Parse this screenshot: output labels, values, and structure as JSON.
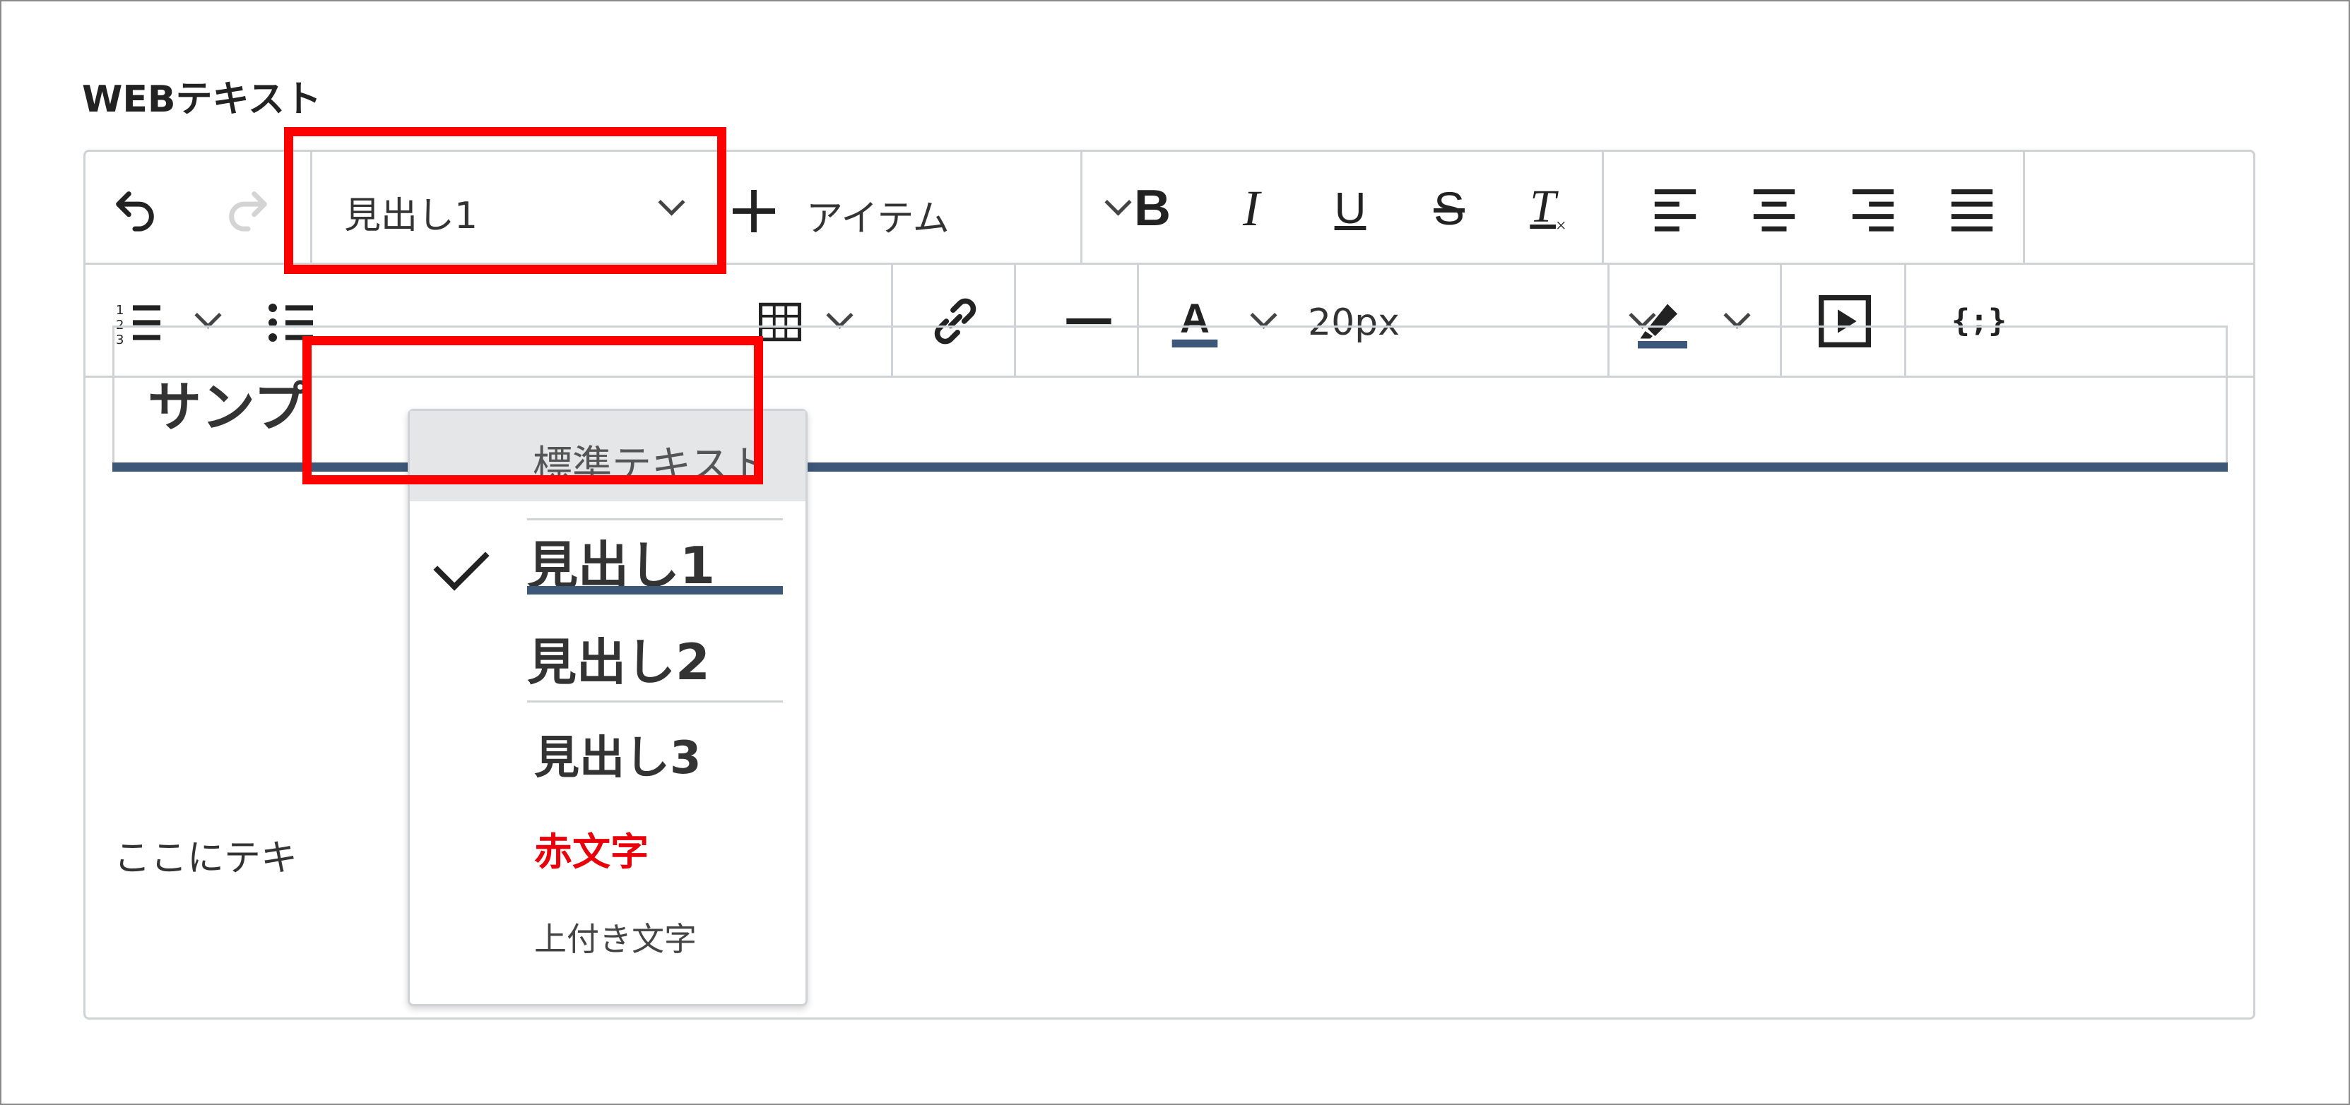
{
  "section_label": "WEBテキスト",
  "toolbar": {
    "block_format_value": "見出し1",
    "insert_item_label": "アイテム",
    "font_size_value": "20px",
    "icons": [
      "undo-icon",
      "redo-icon",
      "plus-icon",
      "bold-icon",
      "italic-icon",
      "underline-icon",
      "strikethrough-icon",
      "clear-format-icon",
      "align-left-icon",
      "align-center-icon",
      "align-right-icon",
      "align-justify-icon",
      "numbered-list-icon",
      "bullet-list-icon",
      "table-icon",
      "link-icon",
      "horizontal-rule-icon",
      "text-color-icon",
      "highlight-icon",
      "media-icon",
      "code-icon"
    ]
  },
  "dropdown": {
    "items": [
      {
        "label": "標準テキスト"
      },
      {
        "label": "見出し1",
        "selected": true
      },
      {
        "label": "見出し2"
      },
      {
        "label": "見出し3"
      },
      {
        "label": "赤文字"
      },
      {
        "label": "上付き文字"
      }
    ]
  },
  "content": {
    "heading_visible": "サンプ",
    "body_visible": "ここにテキ"
  },
  "colors": {
    "accent_blue": "#3c5778",
    "highlight_red": "#ff0000",
    "red_text": "#e8000b",
    "border": "#cfd3d7"
  }
}
